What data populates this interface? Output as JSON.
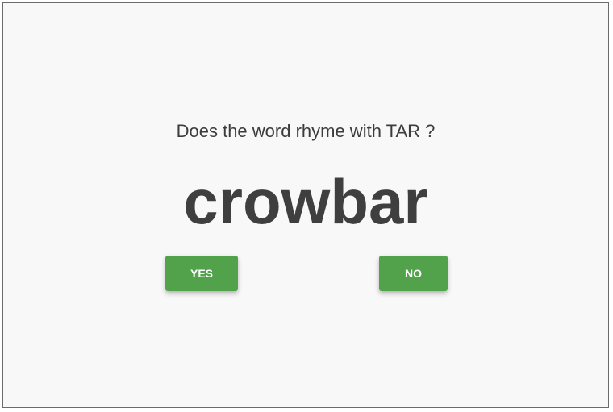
{
  "prompt": {
    "question": "Does the word rhyme with TAR ?"
  },
  "word": {
    "text": "crowbar"
  },
  "buttons": {
    "yes_label": "YES",
    "no_label": "NO"
  },
  "colors": {
    "button_green": "#52a24c",
    "text_dark": "#3f3f3f",
    "background": "#f8f8f8"
  }
}
